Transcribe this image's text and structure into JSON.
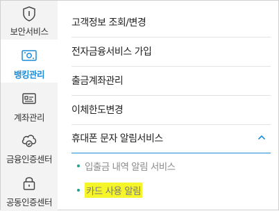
{
  "sidebar": {
    "items": [
      {
        "label": "보안서비스",
        "icon": "shield-icon"
      },
      {
        "label": "뱅킹관리",
        "icon": "money-card-icon",
        "active": true
      },
      {
        "label": "계좌관리",
        "icon": "account-card-icon"
      },
      {
        "label": "금융인증센터",
        "icon": "cloud-check-icon"
      },
      {
        "label": "공동인증센터",
        "icon": "lock-icon"
      }
    ]
  },
  "menu": {
    "items": [
      {
        "label": "고객정보 조회/변경"
      },
      {
        "label": "전자금융서비스 가입"
      },
      {
        "label": "출금계좌관리"
      },
      {
        "label": "이체한도변경"
      },
      {
        "label": "휴대폰 문자 알림서비스",
        "expanded": true
      }
    ],
    "submenu": [
      {
        "label": "입출금 내역 알림 서비스"
      },
      {
        "label": "카드 사용 알림",
        "highlighted": true
      }
    ]
  },
  "colors": {
    "accent": "#1a8bd8",
    "bullet": "#21a38a",
    "highlight": "#f6f529",
    "sidebar_bg": "#f3f3f3"
  }
}
